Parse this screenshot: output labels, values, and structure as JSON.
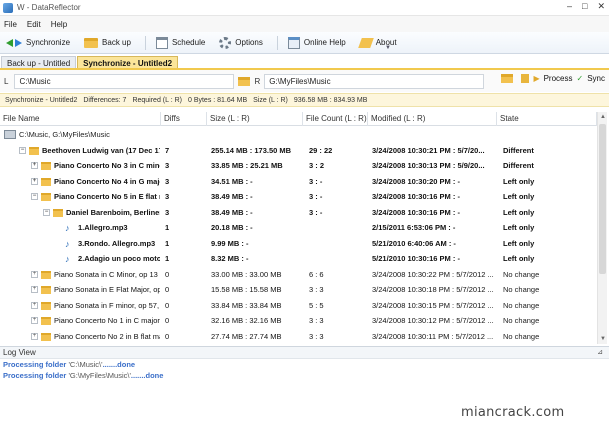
{
  "window": {
    "title": "W - DataReflector",
    "controls": [
      "–",
      "□",
      "✕"
    ]
  },
  "menu": [
    "File",
    "Edit",
    "Help"
  ],
  "toolbar": {
    "synchronize": "Synchronize",
    "backup": "Back up",
    "schedule": "Schedule",
    "options": "Options",
    "online_help": "Online Help",
    "about": "About"
  },
  "tabs": [
    {
      "label": "Back up - Untitled",
      "active": false
    },
    {
      "label": "Synchronize - Untitled2",
      "active": true
    }
  ],
  "paths": {
    "left_label": "L",
    "left_value": "C:\\Music",
    "right_label": "R",
    "right_value": "G:\\MyFiles\\Music",
    "process": "Process",
    "sync": "Sync"
  },
  "status": {
    "title": "Synchronize - Untitled2",
    "differences": "Differences: 7",
    "required": "Required (L : R)",
    "bytes": "0 Bytes : 81.64 MB",
    "size": "Size (L : R)",
    "size_value": "936.58 MB : 834.93 MB"
  },
  "columns": [
    "File Name",
    "Diffs",
    "Size (L : R)",
    "File Count (L : R)",
    "Modified (L : R)",
    "State"
  ],
  "root_path": "C:\\Music, G:\\MyFiles\\Music",
  "rows": [
    {
      "name": "Beethoven Ludwig van (17 Dec 17...",
      "diffs": "7",
      "size": "255.14 MB : 173.50 MB",
      "count": "29 : 22",
      "modified": "3/24/2008 10:30:21 PM : 5/7/20...",
      "state": "Different",
      "level": 0,
      "icon": "folder",
      "expander": "−",
      "bold": true
    },
    {
      "name": "Piano Concerto No 3 in C minor,...",
      "diffs": "3",
      "size": "33.85 MB : 25.21 MB",
      "count": "3 : 2",
      "modified": "3/24/2008 10:30:13 PM : 5/9/20...",
      "state": "Different",
      "level": 1,
      "icon": "folder",
      "expander": "+",
      "bold": true
    },
    {
      "name": "Piano Concerto No 4 in G major...",
      "diffs": "3",
      "size": "34.51 MB : -",
      "count": "3 : -",
      "modified": "3/24/2008 10:30:20 PM : -",
      "state": "Left only",
      "level": 1,
      "icon": "folder",
      "expander": "+",
      "bold": true
    },
    {
      "name": "Piano Concerto No 5 in E flat m...",
      "diffs": "3",
      "size": "38.49 MB : -",
      "count": "3 : -",
      "modified": "3/24/2008 10:30:16 PM : -",
      "state": "Left only",
      "level": 1,
      "icon": "folder",
      "expander": "−",
      "bold": true
    },
    {
      "name": "Daniel Barenboim, Berliner ...",
      "diffs": "3",
      "size": "38.49 MB : -",
      "count": "3 : -",
      "modified": "3/24/2008 10:30:16 PM : -",
      "state": "Left only",
      "level": 2,
      "icon": "folder",
      "expander": "−",
      "bold": true
    },
    {
      "name": "1.Allegro.mp3",
      "diffs": "1",
      "size": "20.18 MB : -",
      "count": "",
      "modified": "2/15/2011 6:53:06 PM : -",
      "state": "Left only",
      "level": 3,
      "icon": "file",
      "expander": "",
      "bold": true
    },
    {
      "name": "3.Rondo. Allegro.mp3",
      "diffs": "1",
      "size": "9.99 MB : -",
      "count": "",
      "modified": "5/21/2010 6:40:06 AM : -",
      "state": "Left only",
      "level": 3,
      "icon": "file",
      "expander": "",
      "bold": true
    },
    {
      "name": "2.Adagio un poco moto...",
      "diffs": "1",
      "size": "8.32 MB : -",
      "count": "",
      "modified": "5/21/2010 10:30:16 PM : -",
      "state": "Left only",
      "level": 3,
      "icon": "file",
      "expander": "",
      "bold": true
    },
    {
      "name": "Piano Sonata in C Minor, op 13",
      "diffs": "0",
      "size": "33.00 MB : 33.00 MB",
      "count": "6 : 6",
      "modified": "3/24/2008 10:30:22 PM : 5/7/2012 ...",
      "state": "No change",
      "level": 1,
      "icon": "folder",
      "expander": "+",
      "bold": false
    },
    {
      "name": "Piano Sonata in E Flat Major, op ...",
      "diffs": "0",
      "size": "15.58 MB : 15.58 MB",
      "count": "3 : 3",
      "modified": "3/24/2008 10:30:18 PM : 5/7/2012 ...",
      "state": "No change",
      "level": 1,
      "icon": "folder",
      "expander": "+",
      "bold": false
    },
    {
      "name": "Piano Sonata in F minor, op 57, ...",
      "diffs": "0",
      "size": "33.84 MB : 33.84 MB",
      "count": "5 : 5",
      "modified": "3/24/2008 10:30:15 PM : 5/7/2012 ...",
      "state": "No change",
      "level": 1,
      "icon": "folder",
      "expander": "+",
      "bold": false
    },
    {
      "name": "Piano Concerto No 1 in C major, ...",
      "diffs": "0",
      "size": "32.16 MB : 32.16 MB",
      "count": "3 : 3",
      "modified": "3/24/2008 10:30:12 PM : 5/7/2012 ...",
      "state": "No change",
      "level": 1,
      "icon": "folder",
      "expander": "+",
      "bold": false
    },
    {
      "name": "Piano Concerto No 2 in B flat ma...",
      "diffs": "0",
      "size": "27.74 MB : 27.74 MB",
      "count": "3 : 3",
      "modified": "3/24/2008 10:30:11 PM : 5/7/2012 ...",
      "state": "No change",
      "level": 1,
      "icon": "folder",
      "expander": "+",
      "bold": false
    }
  ],
  "log": {
    "title": "Log View",
    "pin": "⊿",
    "lines": [
      {
        "prefix": "Processing folder",
        "path": "'C:\\Music\\'",
        "suffix": ".......done"
      },
      {
        "prefix": "Processing folder",
        "path": "'G:\\MyFiles\\Music\\'",
        "suffix": ".......done"
      }
    ]
  },
  "watermark": "miancrack.com"
}
